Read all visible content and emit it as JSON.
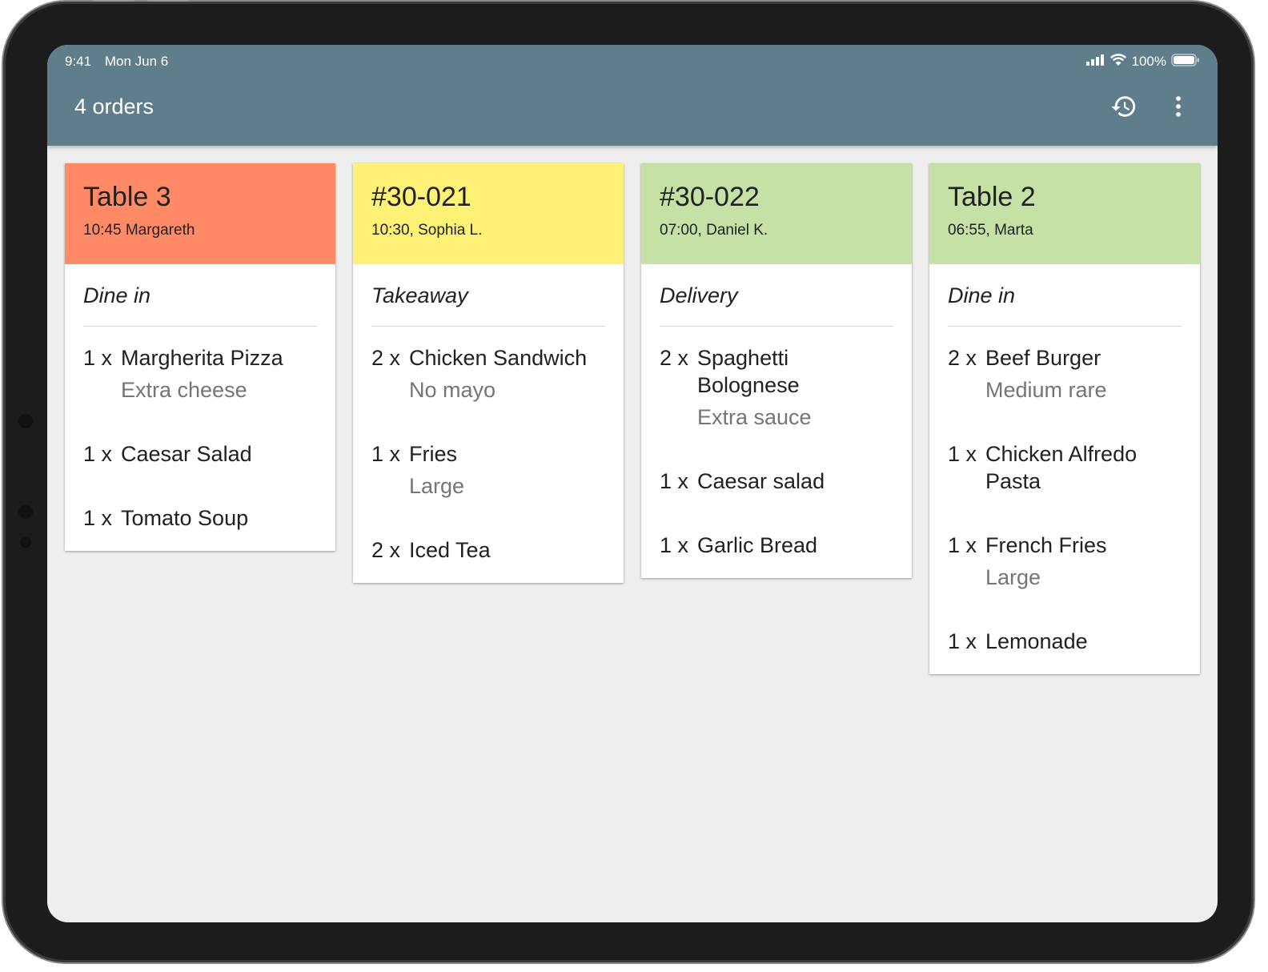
{
  "status_bar": {
    "time": "9:41",
    "date": "Mon Jun 6",
    "battery": "100%"
  },
  "app_bar": {
    "title": "4 orders",
    "history_icon": "history-icon",
    "menu_icon": "more-vert-icon"
  },
  "colors": {
    "app_bar": "#607d8b",
    "urgent": "#ff8a65",
    "warning": "#fff176",
    "ok": "#c5e1a5",
    "background": "#eeeeee"
  },
  "orders": [
    {
      "title": "Table 3",
      "subtitle": "10:45 Margareth",
      "type": "Dine in",
      "color": "#ff8a65",
      "items": [
        {
          "qty": "1 x",
          "name": "Margherita Pizza",
          "mod": "Extra cheese"
        },
        {
          "qty": "1 x",
          "name": "Caesar Salad",
          "mod": ""
        },
        {
          "qty": "1 x",
          "name": "Tomato Soup",
          "mod": ""
        }
      ]
    },
    {
      "title": "#30-021",
      "subtitle": "10:30, Sophia L.",
      "type": "Takeaway",
      "color": "#fff176",
      "items": [
        {
          "qty": "2 x",
          "name": "Chicken Sandwich",
          "mod": "No mayo"
        },
        {
          "qty": "1 x",
          "name": "Fries",
          "mod": "Large"
        },
        {
          "qty": "2 x",
          "name": "Iced Tea",
          "mod": ""
        }
      ]
    },
    {
      "title": "#30-022",
      "subtitle": "07:00, Daniel K.",
      "type": "Delivery",
      "color": "#c5e1a5",
      "items": [
        {
          "qty": "2 x",
          "name": "Spaghetti Bolognese",
          "mod": "Extra sauce"
        },
        {
          "qty": "1 x",
          "name": "Caesar salad",
          "mod": ""
        },
        {
          "qty": "1 x",
          "name": "Garlic Bread",
          "mod": ""
        }
      ]
    },
    {
      "title": "Table 2",
      "subtitle": "06:55, Marta",
      "type": "Dine in",
      "color": "#c5e1a5",
      "items": [
        {
          "qty": "2 x",
          "name": "Beef Burger",
          "mod": "Medium rare"
        },
        {
          "qty": "1 x",
          "name": "Chicken Alfredo Pasta",
          "mod": ""
        },
        {
          "qty": "1 x",
          "name": "French Fries",
          "mod": "Large"
        },
        {
          "qty": "1 x",
          "name": "Lemonade",
          "mod": ""
        }
      ]
    }
  ]
}
